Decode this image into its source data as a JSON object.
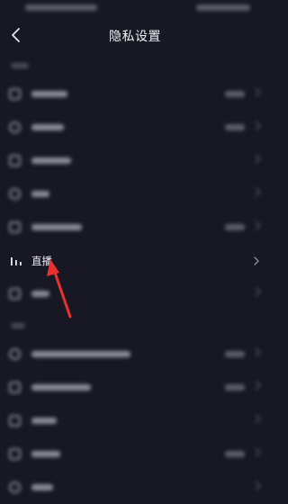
{
  "header": {
    "title": "隐私设置",
    "back_icon": "chevron-left-icon"
  },
  "live_item": {
    "label": "直播",
    "icon": "bar-chart-icon",
    "chevron_icon": "chevron-right-icon"
  },
  "annotation": {
    "color": "#e8312f"
  },
  "colors": {
    "background": "#171823",
    "text_primary": "#f2f2f6",
    "text_secondary": "#8a8c99"
  }
}
